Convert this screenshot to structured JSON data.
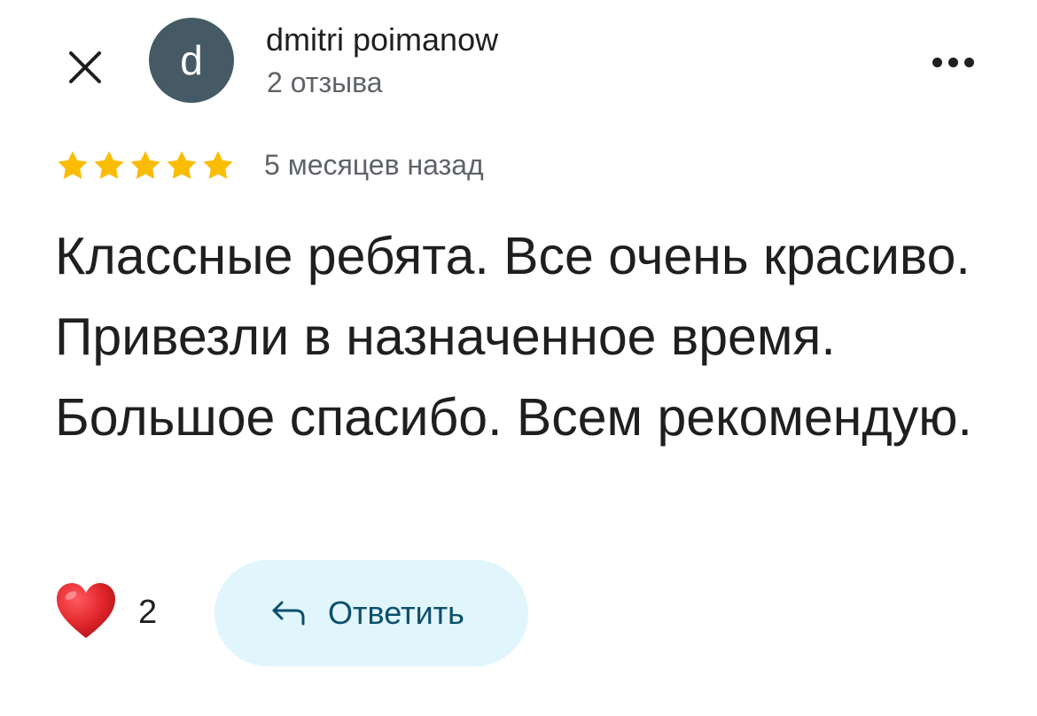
{
  "header": {
    "close_icon": "close-icon",
    "avatar_letter": "d",
    "avatar_color": "#455a64",
    "author_name": "dmitri poimanow",
    "review_count": "2 отзыва",
    "more_icon": "more-horizontal-icon"
  },
  "review": {
    "rating": 5,
    "rating_max": 5,
    "star_color": "#fbbc04",
    "time_ago": "5 месяцев назад",
    "text": "Классные ребята. Все очень красиво. Привезли в назначенное время. Большое спасибо. Всем рекомендую."
  },
  "actions": {
    "like_icon": "heart-icon",
    "like_color": "#e0262b",
    "like_count": "2",
    "reply_icon": "reply-arrow-icon",
    "reply_label": "Ответить",
    "reply_bg": "#e1f5fc"
  }
}
